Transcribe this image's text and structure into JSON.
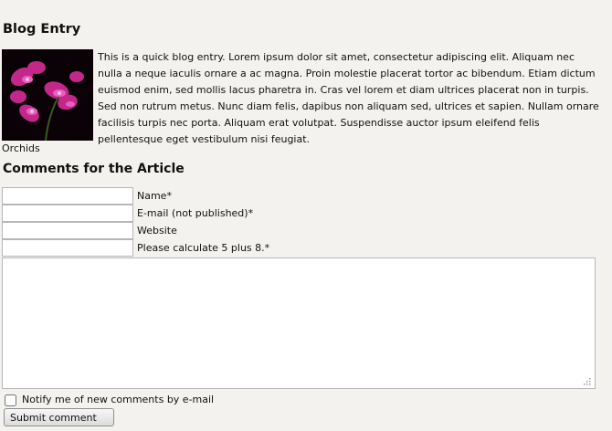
{
  "blog": {
    "title": "Blog Entry",
    "image_caption": "Orchids",
    "body": "This is a quick blog entry.  Lorem ipsum dolor sit amet, consectetur adipiscing elit. Aliquam nec\nnulla a neque iaculis ornare a ac magna. Proin molestie placerat tortor ac bibendum. Etiam dictum\neuismod enim, sed mollis lacus pharetra in. Cras vel lorem et diam ultrices placerat non in turpis.\nSed non rutrum metus. Nunc diam felis, dapibus non aliquam sed, ultrices et sapien. Nullam ornare\nfacilisis turpis nec porta. Aliquam erat volutpat. Suspendisse auctor ipsum eleifend felis\npellentesque eget vestibulum nisi feugiat."
  },
  "comments": {
    "title": "Comments for the Article",
    "fields": {
      "name": {
        "label": "Name*",
        "value": ""
      },
      "email": {
        "label": "E-mail (not published)*",
        "value": ""
      },
      "website": {
        "label": "Website",
        "value": ""
      },
      "captcha": {
        "label": "Please calculate 5 plus 8.*",
        "value": ""
      }
    },
    "comment_text": "",
    "notify_label": "Notify me of new comments by e-mail",
    "notify_checked": false,
    "submit_label": "Submit comment"
  },
  "colors": {
    "background": "#f4f2ee",
    "orchid": "#d6329a"
  }
}
